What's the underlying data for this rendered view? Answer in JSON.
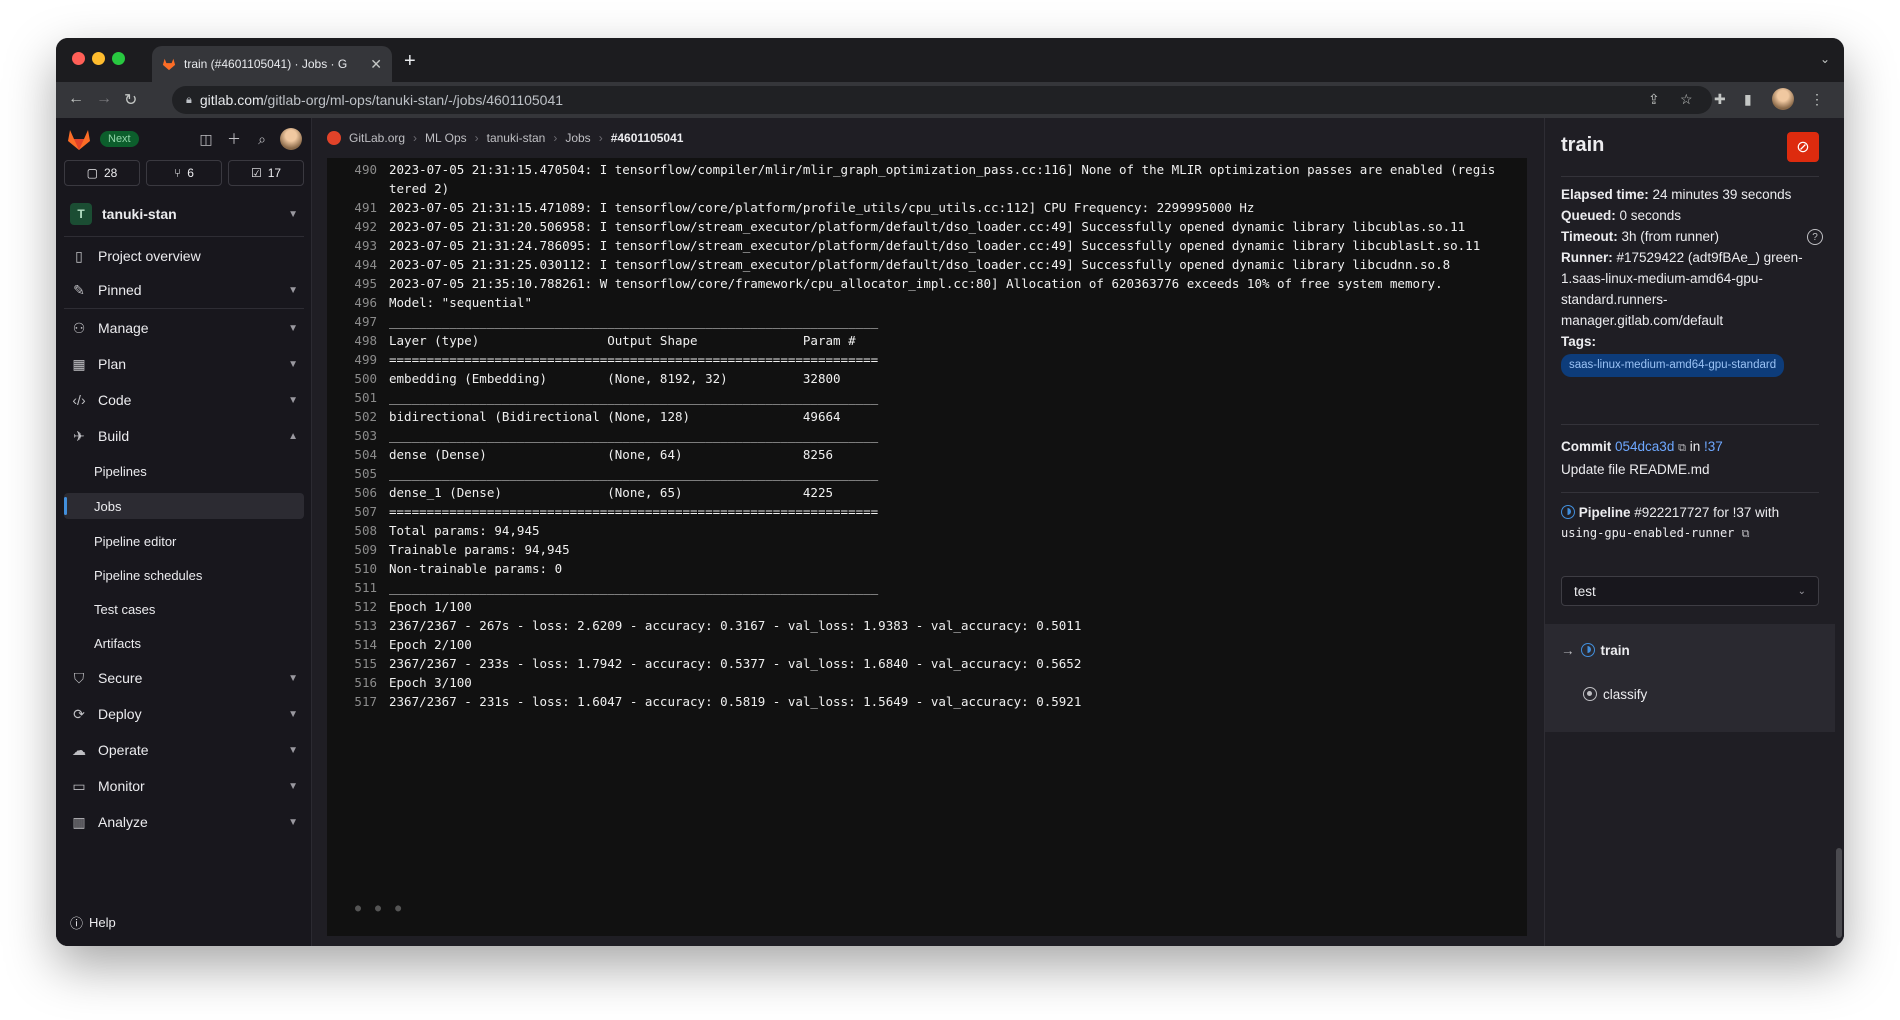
{
  "browser": {
    "tab_title": "train (#4601105041) · Jobs · G",
    "url_host": "gitlab.com",
    "url_path": "/gitlab-org/ml-ops/tanuki-stan/-/jobs/4601105041"
  },
  "sidebar": {
    "next_badge": "Next",
    "counts": {
      "issues": "28",
      "merge_requests": "6",
      "todos": "17"
    },
    "project_initial": "T",
    "project_name": "tanuki-stan",
    "project_overview": "Project overview",
    "pinned": "Pinned",
    "menu": [
      "Manage",
      "Plan",
      "Code",
      "Build"
    ],
    "build_sub": [
      "Pipelines",
      "Jobs",
      "Pipeline editor",
      "Pipeline schedules",
      "Test cases",
      "Artifacts"
    ],
    "menu_after": [
      "Secure",
      "Deploy",
      "Operate",
      "Monitor",
      "Analyze"
    ],
    "help": "Help"
  },
  "breadcrumbs": [
    "GitLab.org",
    "ML Ops",
    "tanuki-stan",
    "Jobs",
    "#4601105041"
  ],
  "log": [
    {
      "n": "490",
      "t": "2023-07-05 21:31:15.470504: I tensorflow/compiler/mlir/mlir_graph_optimization_pass.cc:116] None of the MLIR optimization passes are enabled (registered 2)"
    },
    {
      "n": "491",
      "t": "2023-07-05 21:31:15.471089: I tensorflow/core/platform/profile_utils/cpu_utils.cc:112] CPU Frequency: 2299995000 Hz"
    },
    {
      "n": "492",
      "t": "2023-07-05 21:31:20.506958: I tensorflow/stream_executor/platform/default/dso_loader.cc:49] Successfully opened dynamic library libcublas.so.11"
    },
    {
      "n": "493",
      "t": "2023-07-05 21:31:24.786095: I tensorflow/stream_executor/platform/default/dso_loader.cc:49] Successfully opened dynamic library libcublasLt.so.11"
    },
    {
      "n": "494",
      "t": "2023-07-05 21:31:25.030112: I tensorflow/stream_executor/platform/default/dso_loader.cc:49] Successfully opened dynamic library libcudnn.so.8"
    },
    {
      "n": "495",
      "t": "2023-07-05 21:35:10.788261: W tensorflow/core/framework/cpu_allocator_impl.cc:80] Allocation of 620363776 exceeds 10% of free system memory."
    },
    {
      "n": "496",
      "t": "Model: \"sequential\""
    },
    {
      "n": "497",
      "t": "_________________________________________________________________"
    },
    {
      "n": "498",
      "t": "Layer (type)                 Output Shape              Param #"
    },
    {
      "n": "499",
      "t": "================================================================="
    },
    {
      "n": "500",
      "t": "embedding (Embedding)        (None, 8192, 32)          32800"
    },
    {
      "n": "501",
      "t": "_________________________________________________________________"
    },
    {
      "n": "502",
      "t": "bidirectional (Bidirectional (None, 128)               49664"
    },
    {
      "n": "503",
      "t": "_________________________________________________________________"
    },
    {
      "n": "504",
      "t": "dense (Dense)                (None, 64)                8256"
    },
    {
      "n": "505",
      "t": "_________________________________________________________________"
    },
    {
      "n": "506",
      "t": "dense_1 (Dense)              (None, 65)                4225"
    },
    {
      "n": "507",
      "t": "================================================================="
    },
    {
      "n": "508",
      "t": "Total params: 94,945"
    },
    {
      "n": "509",
      "t": "Trainable params: 94,945"
    },
    {
      "n": "510",
      "t": "Non-trainable params: 0"
    },
    {
      "n": "511",
      "t": "_________________________________________________________________"
    },
    {
      "n": "512",
      "t": "Epoch 1/100"
    },
    {
      "n": "513",
      "t": "2367/2367 - 267s - loss: 2.6209 - accuracy: 0.3167 - val_loss: 1.9383 - val_accuracy: 0.5011"
    },
    {
      "n": "514",
      "t": "Epoch 2/100"
    },
    {
      "n": "515",
      "t": "2367/2367 - 233s - loss: 1.7942 - accuracy: 0.5377 - val_loss: 1.6840 - val_accuracy: 0.5652"
    },
    {
      "n": "516",
      "t": "Epoch 3/100"
    },
    {
      "n": "517",
      "t": "2367/2367 - 231s - loss: 1.6047 - accuracy: 0.5819 - val_loss: 1.5649 - val_accuracy: 0.5921"
    }
  ],
  "job": {
    "title": "train",
    "elapsed_label": "Elapsed time:",
    "elapsed": " 24 minutes 39 seconds",
    "queued_label": "Queued:",
    "queued": " 0 seconds",
    "timeout_label": "Timeout:",
    "timeout": " 3h (from runner)",
    "runner_label": "Runner:",
    "runner": " #17529422 (adt9fBAe_) green-1.saas-linux-medium-amd64-gpu-standard.runners-manager.gitlab.com/default",
    "tags_label": "Tags:",
    "tag": "saas-linux-medium-amd64-gpu-standard",
    "commit_label": "Commit",
    "commit_sha": "054dca3d",
    "commit_in": "in",
    "commit_mr": "!37",
    "commit_msg": "Update file README.md",
    "pipeline_label": "Pipeline",
    "pipeline_text": " #922217727 for !37 with",
    "pipeline_branch": "using-gpu-enabled-runner",
    "stage": "test",
    "jobs": [
      "train",
      "classify"
    ]
  },
  "colors": {
    "accent": "#428fdc",
    "cancel": "#dd2b0e",
    "tag_bg": "#0d3c7a"
  }
}
